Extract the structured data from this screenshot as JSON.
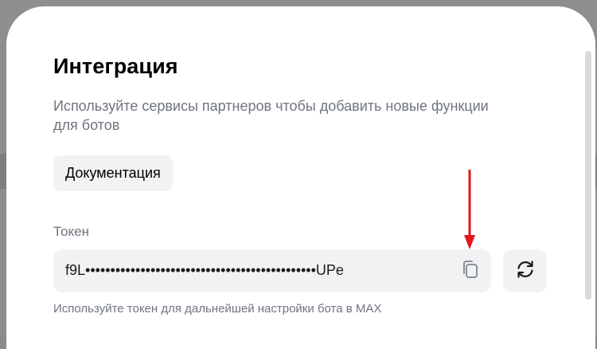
{
  "modal": {
    "title": "Интеграция",
    "subtitle": "Используйте сервисы партнеров чтобы добавить новые функции для ботов",
    "documentation_button": "Документация"
  },
  "token": {
    "label": "Токен",
    "value": "f9L••••••••••••••••••••••••••••••••••••••••••••••UPe",
    "hint": "Используйте токен для дальнейшей настройки бота в MAX",
    "copy_icon": "copy-icon",
    "refresh_icon": "refresh-icon"
  },
  "colors": {
    "annotation_arrow": "#e3141b",
    "muted_text": "#6f7480",
    "field_background": "#f1f2f4"
  }
}
